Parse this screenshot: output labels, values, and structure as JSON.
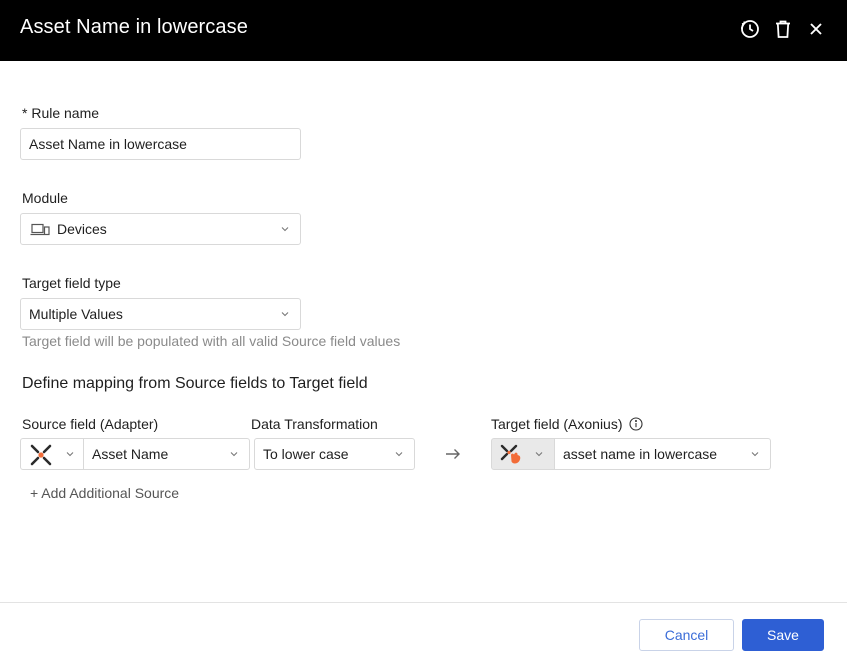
{
  "header": {
    "title": "Asset Name in lowercase",
    "icons": [
      "history-icon",
      "trash-icon",
      "close-icon"
    ]
  },
  "rule_name": {
    "label": "* Rule name",
    "value": "Asset Name in lowercase"
  },
  "module": {
    "label": "Module",
    "icon": "devices-icon",
    "value": "Devices"
  },
  "target_field_type": {
    "label": "Target field type",
    "value": "Multiple Values",
    "hint": "Target field will be populated with all valid Source field values"
  },
  "mapping": {
    "title": "Define mapping from Source fields to Target field",
    "source_label": "Source field (Adapter)",
    "source_adapter_icon": "axonius-adapter-icon",
    "source_value": "Asset Name",
    "transformation_label": "Data Transformation",
    "transformation_value": "To lower case",
    "arrow_icon": "arrow-right-icon",
    "target_label": "Target field (Axonius)",
    "target_info_icon": "info-icon",
    "target_adapter_icon": "axonius-custom-icon",
    "target_value": "asset name in lowercase",
    "add_source_label": "+ Add Additional Source"
  },
  "footer": {
    "cancel_label": "Cancel",
    "save_label": "Save"
  },
  "colors": {
    "header_bg": "#000000",
    "primary": "#2e5fd4",
    "accent_orange": "#f26c38"
  }
}
